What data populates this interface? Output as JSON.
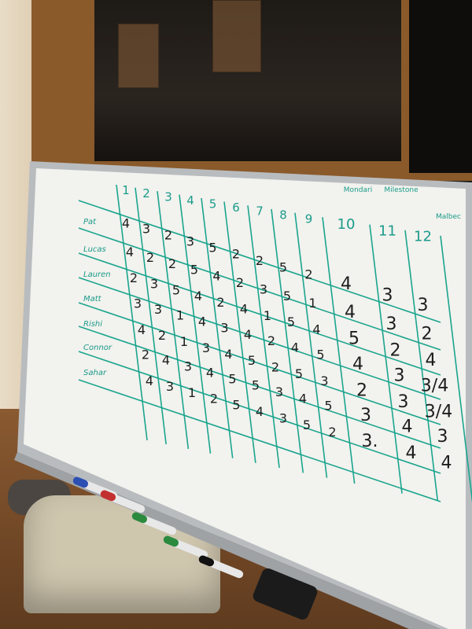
{
  "board": {
    "column_headers": [
      "1",
      "2",
      "3",
      "4",
      "5",
      "6",
      "7",
      "8",
      "9",
      "10",
      "11",
      "12"
    ],
    "header_notes": [
      "Mondari",
      "Milestone",
      "Malbec"
    ],
    "rows": [
      {
        "name": "Pat",
        "values": [
          "4",
          "3",
          "2",
          "3",
          "5",
          "2",
          "2",
          "5",
          "2",
          "4",
          "3",
          "3"
        ]
      },
      {
        "name": "Lucas",
        "values": [
          "4",
          "2",
          "2",
          "5",
          "4",
          "2",
          "3",
          "5",
          "1",
          "4",
          "3",
          "2"
        ]
      },
      {
        "name": "Lauren",
        "values": [
          "2",
          "3",
          "5",
          "4",
          "2",
          "4",
          "1",
          "5",
          "4",
          "5",
          "2",
          "4"
        ]
      },
      {
        "name": "Matt",
        "values": [
          "3",
          "3",
          "1",
          "4",
          "3",
          "4",
          "2",
          "4",
          "5",
          "4",
          "3",
          "3/4"
        ]
      },
      {
        "name": "Rishi",
        "values": [
          "4",
          "2",
          "1",
          "3",
          "4",
          "5",
          "2",
          "5",
          "3",
          "2",
          "3",
          "3/4"
        ]
      },
      {
        "name": "Connor",
        "values": [
          "2",
          "4",
          "3",
          "4",
          "5",
          "5",
          "3",
          "4",
          "5",
          "3",
          "4",
          "3"
        ]
      },
      {
        "name": "Sahar",
        "values": [
          "4",
          "3",
          "1",
          "2",
          "5",
          "4",
          "3",
          "5",
          "2",
          "3.",
          "4",
          "4"
        ]
      }
    ]
  },
  "markers": [
    {
      "name": "blue-marker",
      "color": "#2b4fb3"
    },
    {
      "name": "red-marker",
      "color": "#c23030"
    },
    {
      "name": "green-marker",
      "color": "#2c8a3f"
    },
    {
      "name": "green-marker-2",
      "color": "#2c8a3f"
    },
    {
      "name": "black-marker",
      "color": "#111111"
    }
  ],
  "colors": {
    "grid": "#1aa58e",
    "ink": "#1d1d1d",
    "board": "#f2f2ee",
    "frame": "#b9bcbf"
  }
}
